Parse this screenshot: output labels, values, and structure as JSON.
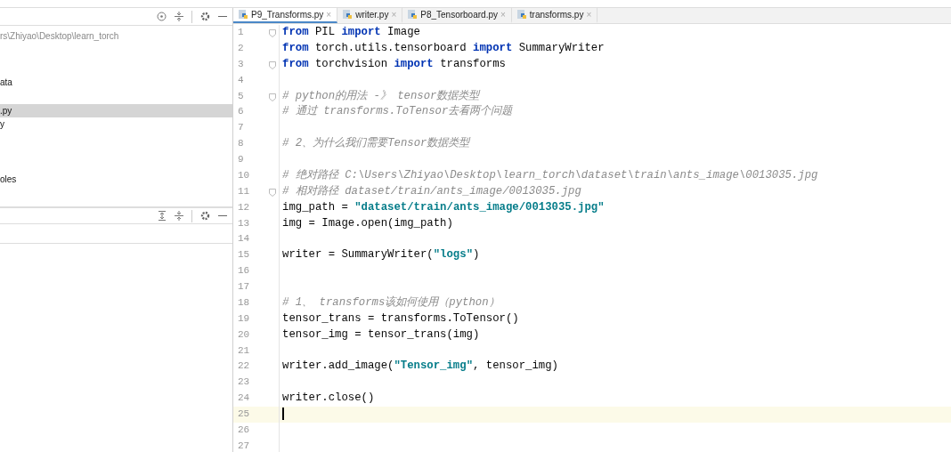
{
  "project_panel": {
    "path": "rs\\Zhiyao\\Desktop\\learn_torch",
    "items": [
      {
        "label": "ata",
        "selected": false
      },
      {
        "label": ".py",
        "selected": true
      },
      {
        "label": "y",
        "selected": false
      },
      {
        "label": "oles",
        "selected": false
      }
    ]
  },
  "tabs": [
    {
      "label": "P9_Transforms.py",
      "close": "×",
      "selected": true
    },
    {
      "label": "writer.py",
      "close": "×",
      "selected": false
    },
    {
      "label": "P8_Tensorboard.py",
      "close": "×",
      "selected": false
    },
    {
      "label": "transforms.py",
      "close": "×",
      "selected": false
    }
  ],
  "code": [
    {
      "number": "1",
      "fold": true,
      "segments": [
        {
          "kind": "keyword",
          "text": "from"
        },
        {
          "kind": "plain",
          "text": " PIL "
        },
        {
          "kind": "keyword",
          "text": "import"
        },
        {
          "kind": "plain",
          "text": " Image"
        }
      ]
    },
    {
      "number": "2",
      "segments": [
        {
          "kind": "keyword",
          "text": "from"
        },
        {
          "kind": "plain",
          "text": " torch.utils.tensorboard "
        },
        {
          "kind": "keyword",
          "text": "import"
        },
        {
          "kind": "plain",
          "text": " SummaryWriter"
        }
      ]
    },
    {
      "number": "3",
      "fold": true,
      "segments": [
        {
          "kind": "keyword",
          "text": "from"
        },
        {
          "kind": "plain",
          "text": " torchvision "
        },
        {
          "kind": "keyword",
          "text": "import"
        },
        {
          "kind": "plain",
          "text": " transforms"
        }
      ]
    },
    {
      "number": "4"
    },
    {
      "number": "5",
      "fold": true,
      "segments": [
        {
          "kind": "comment",
          "text": "# python的用法 -》 tensor数据类型"
        }
      ]
    },
    {
      "number": "6",
      "segments": [
        {
          "kind": "comment",
          "text": "# 通过 transforms.ToTensor去看两个问题"
        }
      ]
    },
    {
      "number": "7"
    },
    {
      "number": "8",
      "segments": [
        {
          "kind": "comment",
          "text": "# 2、为什么我们需要Tensor数据类型"
        }
      ]
    },
    {
      "number": "9"
    },
    {
      "number": "10",
      "segments": [
        {
          "kind": "comment",
          "text": "# 绝对路径 C:\\Users\\Zhiyao\\Desktop\\learn_torch\\dataset\\train\\ants_image\\0013035.jpg"
        }
      ]
    },
    {
      "number": "11",
      "fold": true,
      "segments": [
        {
          "kind": "comment",
          "text": "# 相对路径 dataset/train/ants_image/0013035.jpg"
        }
      ]
    },
    {
      "number": "12",
      "segments": [
        {
          "kind": "plain",
          "text": "img_path = "
        },
        {
          "kind": "string",
          "text": "\"dataset/train/ants_image/0013035.jpg\""
        }
      ]
    },
    {
      "number": "13",
      "segments": [
        {
          "kind": "plain",
          "text": "img = Image.open(img_path)"
        }
      ]
    },
    {
      "number": "14"
    },
    {
      "number": "15",
      "segments": [
        {
          "kind": "plain",
          "text": "writer = SummaryWriter("
        },
        {
          "kind": "string",
          "text": "\"logs\""
        },
        {
          "kind": "plain",
          "text": ")"
        }
      ]
    },
    {
      "number": "16"
    },
    {
      "number": "17"
    },
    {
      "number": "18",
      "segments": [
        {
          "kind": "comment",
          "text": "# 1、 transforms该如何使用（python）"
        }
      ]
    },
    {
      "number": "19",
      "segments": [
        {
          "kind": "plain",
          "text": "tensor_trans = transforms.ToTensor()"
        }
      ]
    },
    {
      "number": "20",
      "segments": [
        {
          "kind": "plain",
          "text": "tensor_img = tensor_trans(img)"
        }
      ]
    },
    {
      "number": "21"
    },
    {
      "number": "22",
      "segments": [
        {
          "kind": "plain",
          "text": "writer.add_image("
        },
        {
          "kind": "string",
          "text": "\"Tensor_img\""
        },
        {
          "kind": "plain",
          "text": ", tensor_img)"
        }
      ]
    },
    {
      "number": "23"
    },
    {
      "number": "24",
      "segments": [
        {
          "kind": "plain",
          "text": "writer.close()"
        }
      ]
    },
    {
      "number": "25",
      "current": true
    },
    {
      "number": "26"
    },
    {
      "number": "27"
    }
  ]
}
